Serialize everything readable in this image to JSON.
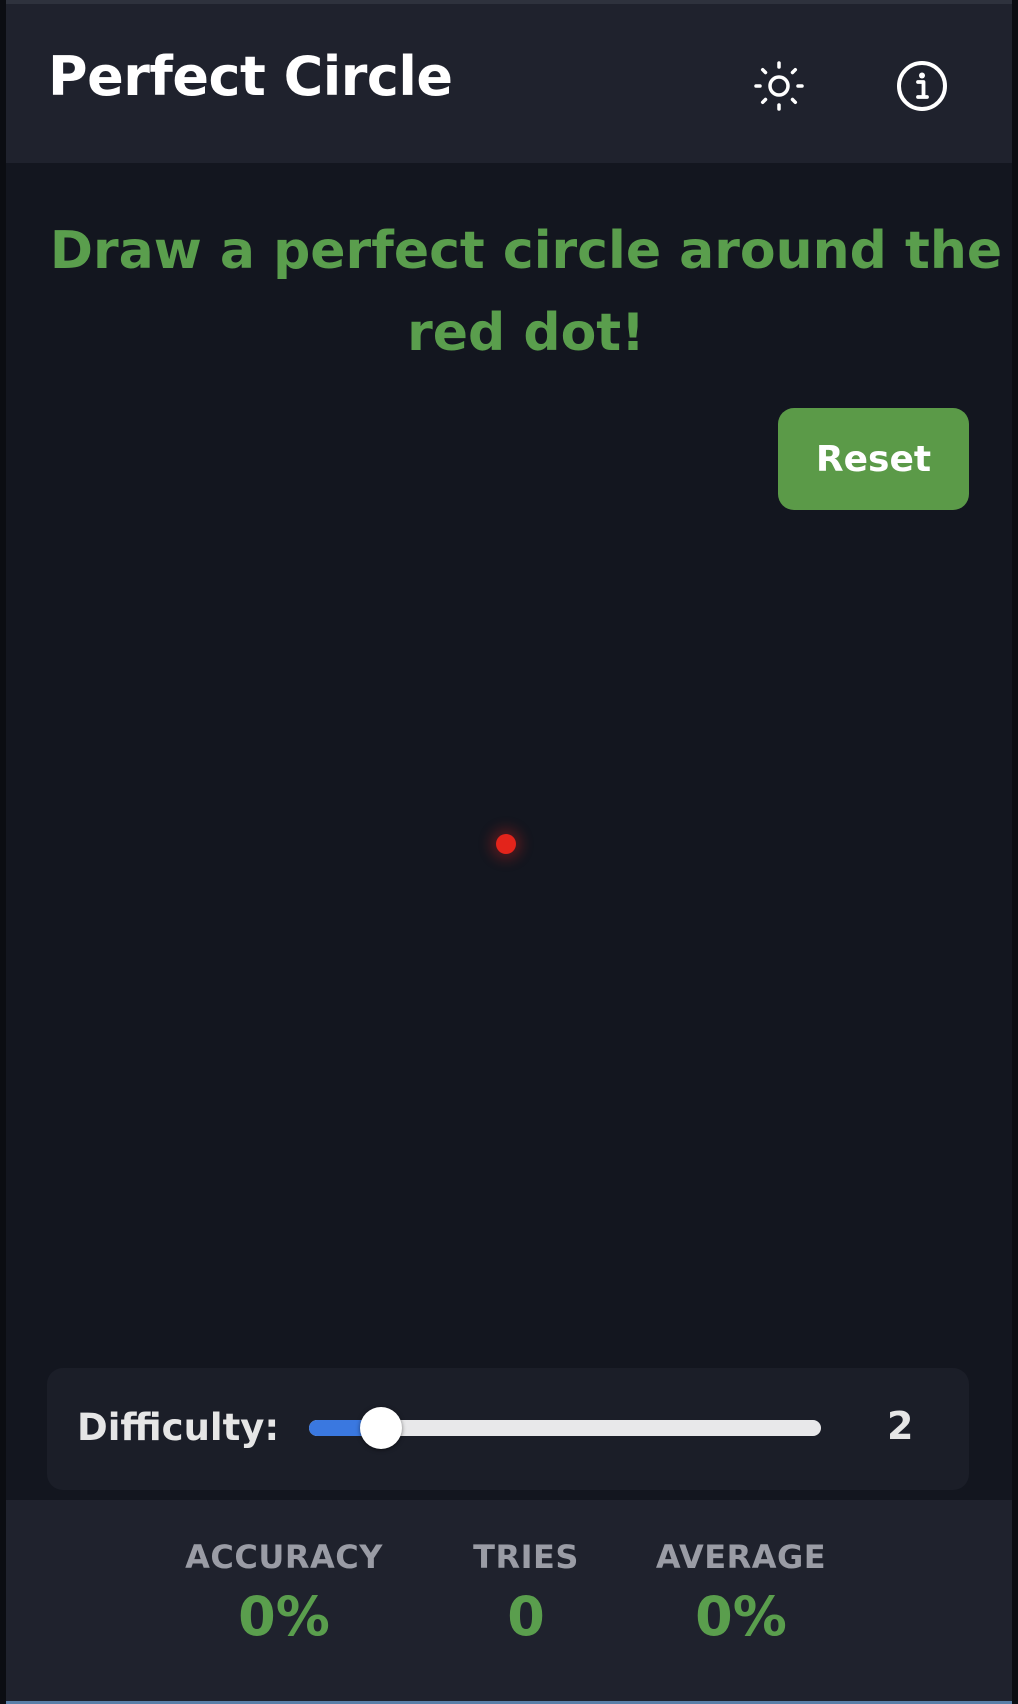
{
  "header": {
    "title": "Perfect Circle",
    "theme_icon": "sun-icon",
    "info_icon": "info-icon"
  },
  "game": {
    "instruction": "Draw a perfect circle around the red dot!",
    "reset_label": "Reset",
    "dot_color": "#e3241b"
  },
  "difficulty": {
    "label": "Difficulty:",
    "value": "2",
    "fill_fraction": 0.14
  },
  "stats": {
    "accuracy": {
      "label": "ACCURACY",
      "value": "0%"
    },
    "tries": {
      "label": "TRIES",
      "value": "0"
    },
    "average": {
      "label": "AVERAGE",
      "value": "0%"
    }
  },
  "colors": {
    "accent_green": "#5a9e4d",
    "slider_blue": "#3a78e0",
    "background": "#13161f"
  }
}
